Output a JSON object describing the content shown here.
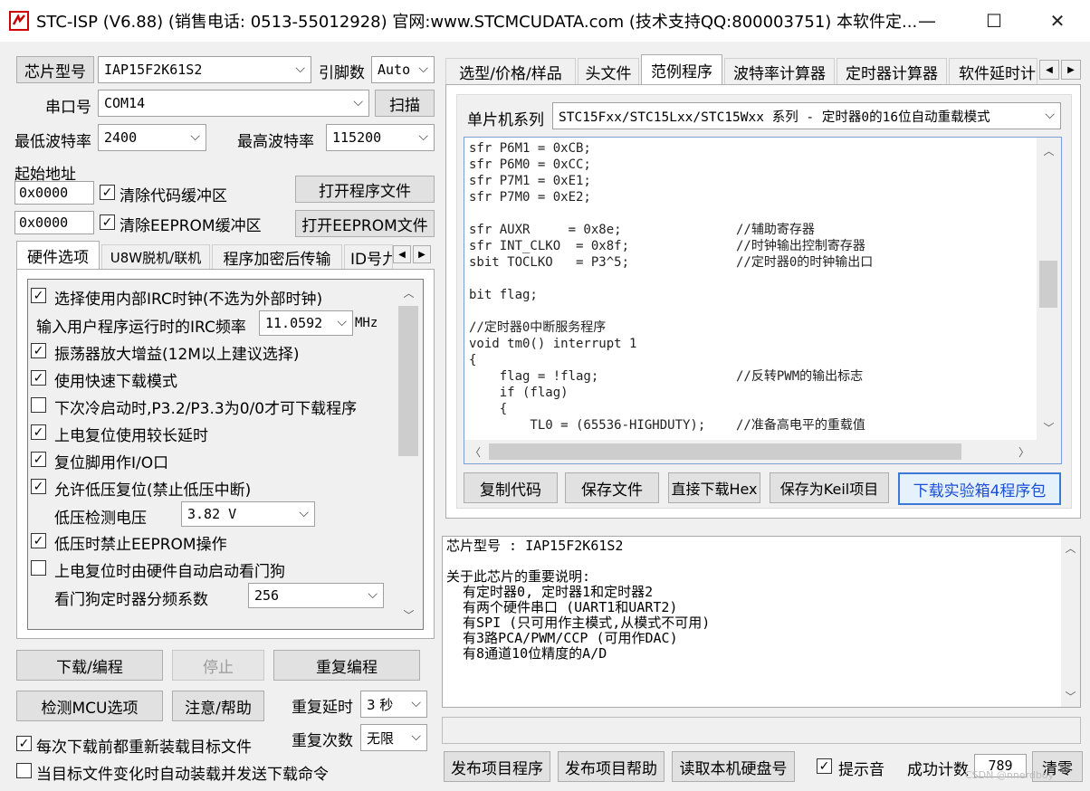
{
  "window": {
    "title": "STC-ISP (V6.88) (销售电话: 0513-55012928) 官网:www.STCMCUDATA.com  (技术支持QQ:800003751) 本软件定...",
    "min": "—",
    "max": "☐",
    "close": "✕"
  },
  "left": {
    "chip_label": "芯片型号",
    "chip_value": "IAP15F2K61S2",
    "pin_label": "引脚数",
    "pin_value": "Auto",
    "port_label": "串口号",
    "port_value": "COM14",
    "scan_label": "扫描",
    "min_baud_label": "最低波特率",
    "min_baud_value": "2400",
    "max_baud_label": "最高波特率",
    "max_baud_value": "115200",
    "start_addr_label": "起始地址",
    "addr1": "0x0000",
    "clear_code_label": "清除代码缓冲区",
    "addr2": "0x0000",
    "clear_eeprom_label": "清除EEPROM缓冲区",
    "open_prog_label": "打开程序文件",
    "open_eeprom_label": "打开EEPROM文件",
    "tabs": [
      "硬件选项",
      "U8W脱机/联机",
      "程序加密后传输",
      "ID号九"
    ],
    "options": {
      "irc": "选择使用内部IRC时钟(不选为外部时钟)",
      "irc_freq_label": "输入用户程序运行时的IRC频率",
      "irc_freq_value": "11.0592",
      "irc_unit": "MHz",
      "osc_gain": "振荡器放大增益(12M以上建议选择)",
      "fast_dl": "使用快速下载模式",
      "cold_boot": "下次冷启动时,P3.2/P3.3为0/0才可下载程序",
      "long_reset": "上电复位使用较长延时",
      "reset_io": "复位脚用作I/O口",
      "lvr": "允许低压复位(禁止低压中断)",
      "lv_label": "低压检测电压",
      "lv_value": "3.82 V",
      "lv_eeprom": "低压时禁止EEPROM操作",
      "wdt": "上电复位时由硬件自动启动看门狗",
      "wdt_div_label": "看门狗定时器分频系数",
      "wdt_div_value": "256"
    },
    "download_label": "下载/编程",
    "stop_label": "停止",
    "reprog_label": "重复编程",
    "check_mcu_label": "检测MCU选项",
    "help_label": "注意/帮助",
    "repeat_delay_label": "重复延时",
    "repeat_delay_value": "3 秒",
    "repeat_count_label": "重复次数",
    "repeat_count_value": "无限",
    "reload_label": "每次下载前都重新装载目标文件",
    "autoload_label": "当目标文件变化时自动装载并发送下载命令"
  },
  "right": {
    "tabs": [
      "选型/价格/样品",
      "头文件",
      "范例程序",
      "波特率计算器",
      "定时器计算器",
      "软件延时计"
    ],
    "series_label": "单片机系列",
    "series_value": "STC15Fxx/STC15Lxx/STC15Wxx 系列 - 定时器0的16位自动重载模式",
    "code_lines": [
      "sfr P6M1 = 0xCB;",
      "sfr P6M0 = 0xCC;",
      "sfr P7M1 = 0xE1;",
      "sfr P7M0 = 0xE2;",
      "",
      "sfr AUXR     = 0x8e;               //辅助寄存器",
      "sfr INT_CLKO  = 0x8f;              //时钟输出控制寄存器",
      "sbit TOCLKO   = P3^5;              //定时器0的时钟输出口",
      "",
      "bit flag;",
      "",
      "//定时器0中断服务程序",
      "void tm0() interrupt 1",
      "{",
      "    flag = !flag;                  //反转PWM的输出标志",
      "    if (flag)",
      "    {",
      "        TL0 = (65536-HIGHDUTY);    //准备高电平的重载值"
    ],
    "copy_code": "复制代码",
    "save_file": "保存文件",
    "direct_dl": "直接下载Hex",
    "save_keil": "保存为Keil项目",
    "dl_kit": "下载实验箱4程序包",
    "info_lines": [
      "芯片型号 : IAP15F2K61S2",
      "",
      "关于此芯片的重要说明:",
      "  有定时器0, 定时器1和定时器2",
      "  有两个硬件串口 (UART1和UART2)",
      "  有SPI (只可用作主模式,从模式不可用)",
      "  有3路PCA/PWM/CCP (可用作DAC)",
      "  有8通道10位精度的A/D"
    ],
    "publish_prog": "发布项目程序",
    "publish_help": "发布项目帮助",
    "read_disk": "读取本机硬盘号",
    "beep_label": "提示音",
    "success_label": "成功计数",
    "success_value": "789",
    "clear_label": "清零"
  },
  "watermark": "CSDN @nnerdboy"
}
